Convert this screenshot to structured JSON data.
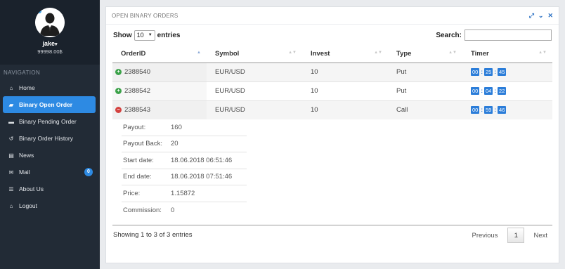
{
  "profile": {
    "username": "jake",
    "balance": "99998.00$"
  },
  "navigation": {
    "title": "NAVIGATION",
    "items": [
      {
        "label": "Home",
        "icon": "home-icon"
      },
      {
        "label": "Binary Open Order",
        "icon": "folder-open-icon"
      },
      {
        "label": "Binary Pending Order",
        "icon": "folder-icon"
      },
      {
        "label": "Binary Order History",
        "icon": "history-icon"
      },
      {
        "label": "News",
        "icon": "newspaper-icon"
      },
      {
        "label": "Mail",
        "icon": "envelope-icon",
        "badge": "0"
      },
      {
        "label": "About Us",
        "icon": "list-icon"
      },
      {
        "label": "Logout",
        "icon": "home-icon"
      }
    ],
    "active": "Binary Open Order"
  },
  "panel": {
    "title": "OPEN BINARY ORDERS"
  },
  "controls": {
    "show_label": "Show",
    "page_size": "10",
    "entries_label": "entries",
    "search_label": "Search:",
    "search_value": ""
  },
  "table": {
    "columns": [
      "OrderID",
      "Symbol",
      "Invest",
      "Type",
      "Timer"
    ],
    "rows": [
      {
        "status": "up",
        "id": "2388540",
        "symbol": "EUR/USD",
        "invest": "10",
        "type": "Put",
        "timer": [
          "00",
          "25",
          "45"
        ]
      },
      {
        "status": "up",
        "id": "2388542",
        "symbol": "EUR/USD",
        "invest": "10",
        "type": "Put",
        "timer": [
          "00",
          "04",
          "22"
        ]
      },
      {
        "status": "down",
        "id": "2388543",
        "symbol": "EUR/USD",
        "invest": "10",
        "type": "Call",
        "timer": [
          "00",
          "59",
          "46"
        ]
      }
    ]
  },
  "details": [
    {
      "label": "Payout:",
      "value": "160"
    },
    {
      "label": "Payout Back:",
      "value": "20"
    },
    {
      "label": "Start date:",
      "value": "18.06.2018 06:51:46"
    },
    {
      "label": "End date:",
      "value": "18.06.2018 07:51:46"
    },
    {
      "label": "Price:",
      "value": "1.15872"
    },
    {
      "label": "Commission:",
      "value": "0"
    }
  ],
  "footer": {
    "info": "Showing 1 to 3 of 3 entries",
    "previous": "Previous",
    "current_page": "1",
    "next": "Next"
  },
  "colors": {
    "accent": "#2d8ae3",
    "sidebar": "#222b36",
    "status_up": "#3ca24a",
    "status_down": "#d4423f"
  }
}
